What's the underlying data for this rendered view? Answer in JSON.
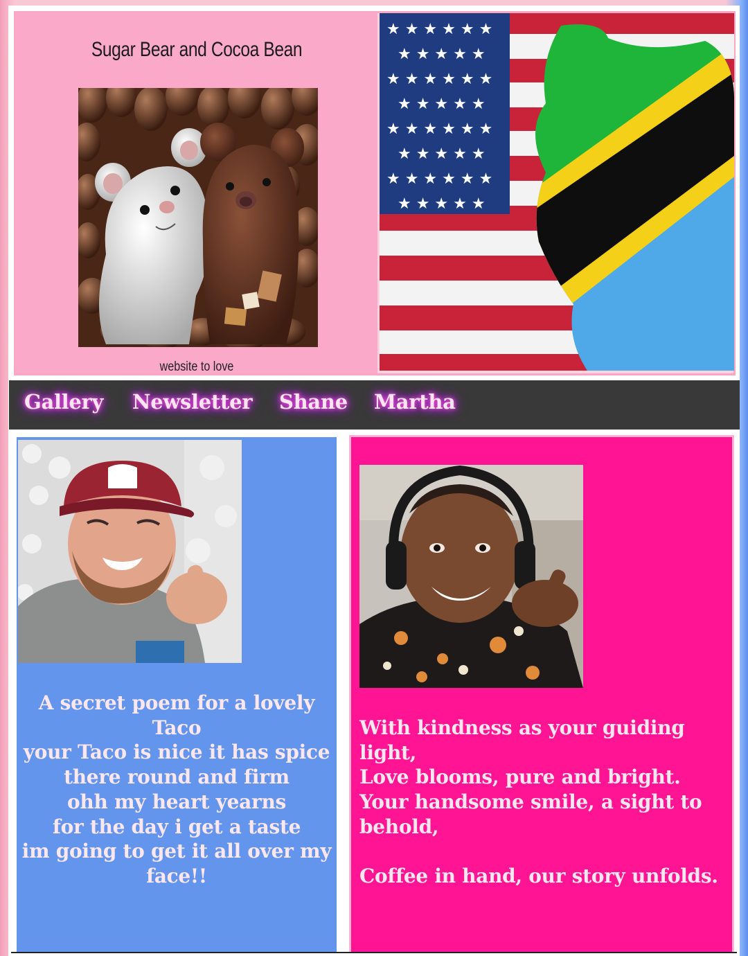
{
  "header": {
    "title": "Sugar Bear and Cocoa Bean",
    "tagline": "website to love"
  },
  "nav": {
    "items": [
      {
        "label": "Gallery"
      },
      {
        "label": "Newsletter"
      },
      {
        "label": "Shane"
      },
      {
        "label": "Martha"
      }
    ]
  },
  "left_column": {
    "poem": [
      "A secret poem for a lovely Taco",
      "your Taco is nice it has spice",
      "there round and firm",
      "ohh my heart yearns",
      "for the day i get a taste",
      "im going to get it all over my face!!"
    ]
  },
  "right_column": {
    "poem": [
      "With kindness as your guiding light,",
      "Love blooms, pure and bright.",
      "Your handsome smile, a sight to behold,",
      "",
      "Coffee in hand, our story unfolds."
    ]
  },
  "colors": {
    "header_pink": "#fba9c8",
    "nav_bg": "#393939",
    "nav_glow": "#d040ff",
    "left_panel": "#6495ed",
    "right_panel": "#ff1493",
    "poem_text": "#fde7ef"
  }
}
